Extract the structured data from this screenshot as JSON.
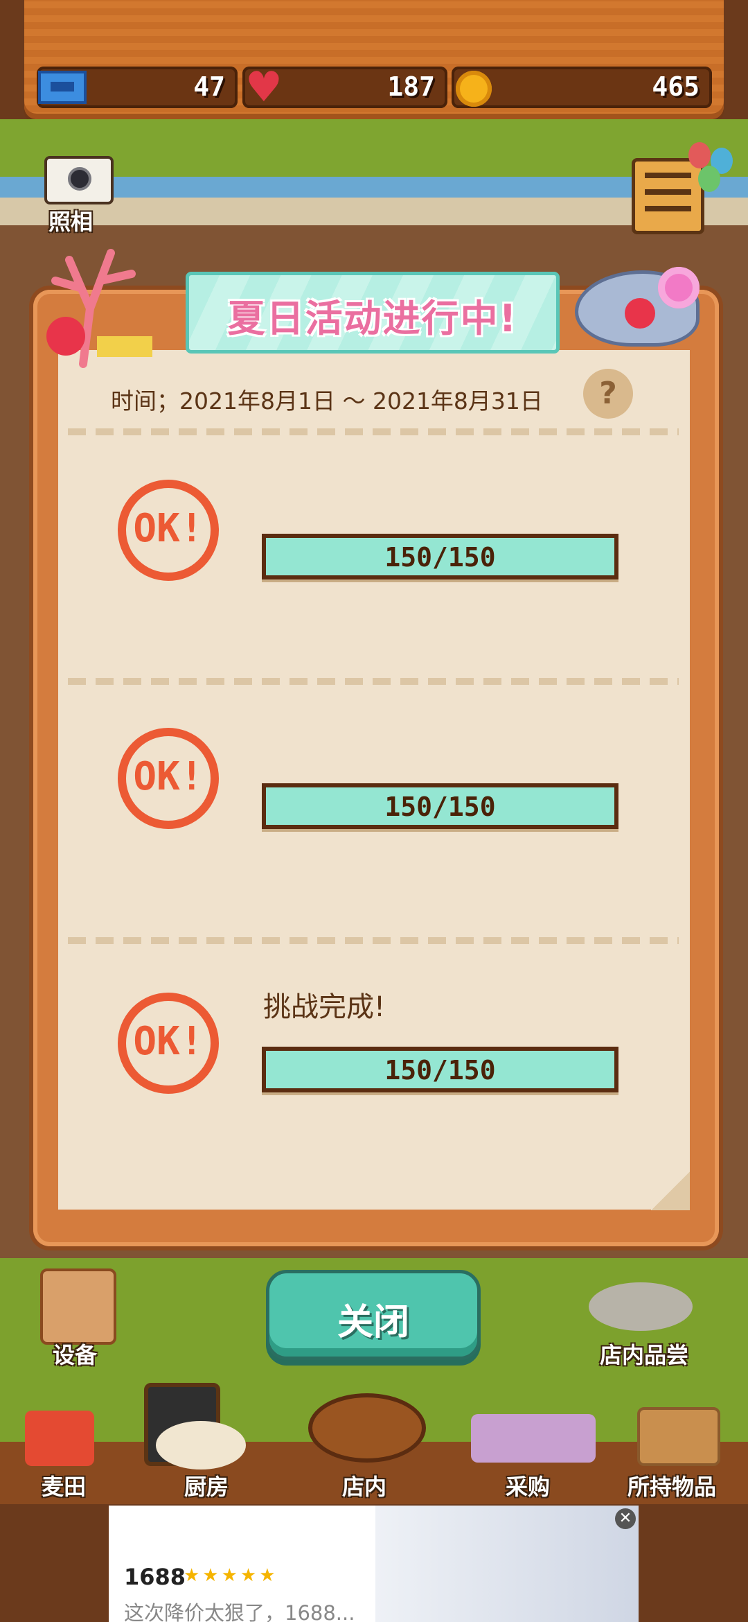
{
  "resources": {
    "tickets": "47",
    "hearts": "187",
    "coins": "465"
  },
  "camera_label": "照相",
  "dialog": {
    "banner_title": "夏日活动进行中!",
    "time": "时间；2021年8月1日 ～ 2021年8月31日",
    "help_label": "?",
    "challenges": [
      {
        "badge": "OK!",
        "progress_text": "150/150",
        "progress": 1.0,
        "label": ""
      },
      {
        "badge": "OK!",
        "progress_text": "150/150",
        "progress": 1.0,
        "label": ""
      },
      {
        "badge": "OK!",
        "progress_text": "150/150",
        "progress": 1.0,
        "label": "挑战完成!"
      }
    ],
    "close_label": "关闭"
  },
  "hud": {
    "equipment": "设备",
    "tasting": "店内品尝",
    "field": "麦田",
    "kitchen": "厨房",
    "shop": "店内",
    "purchase": "采购",
    "inventory": "所持物品"
  },
  "ad": {
    "title": "1688",
    "stars": "★★★★★",
    "desc": "这次降价太狠了，1688...",
    "close": "✕"
  },
  "colors": {
    "accent_teal": "#4fc5ad",
    "ok_red": "#ec5a34",
    "banner_pink": "#ea6fa0"
  }
}
